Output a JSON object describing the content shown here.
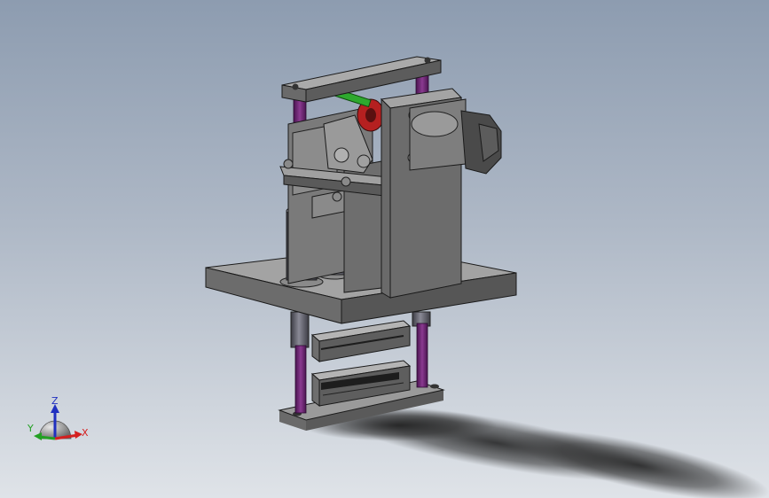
{
  "viewport": {
    "background_top": "#8d9cb0",
    "background_bottom": "#dfe3e8"
  },
  "triad": {
    "x_label": "X",
    "y_label": "Y",
    "z_label": "Z",
    "x_color": "#d42020",
    "y_color": "#23a023",
    "z_color": "#2030c0"
  },
  "model": {
    "icon": "press-die-assembly-icon",
    "rod_color": "#6a1f6e",
    "body_color": "#5e5e5e",
    "highlight_green": "#2ea82e",
    "highlight_red": "#b52020"
  }
}
